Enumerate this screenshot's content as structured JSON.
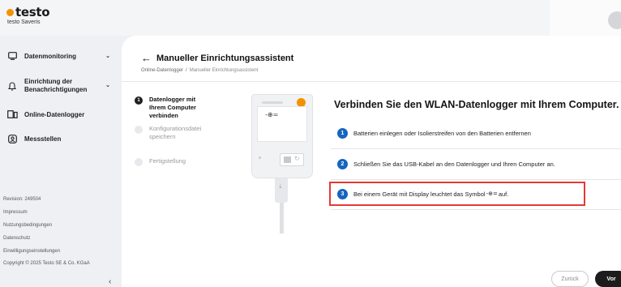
{
  "brand": {
    "name": "testo",
    "subtitle": "testo Saveris",
    "accent": "#f39200"
  },
  "sidebar": {
    "items": [
      {
        "label": "Datenmonitoring",
        "icon": "monitor-icon",
        "has_chevron": true
      },
      {
        "label": "Einrichtung der Benachrichtigungen",
        "icon": "bell-icon",
        "has_chevron": true
      },
      {
        "label": "Online-Datenlogger",
        "icon": "data-logger-icon",
        "has_chevron": false
      },
      {
        "label": "Messstellen",
        "icon": "measuring-point-icon",
        "has_chevron": false
      }
    ],
    "footer": {
      "revision": "Revision: 249504",
      "links": [
        "Impressum",
        "Nutzungsbedingungen",
        "Datenschutz",
        "Einwilligungseinstellungen"
      ],
      "copyright": "Copyright © 2025 Testo SE & Co. KGaA"
    }
  },
  "header": {
    "title": "Manueller Einrichtungsassistent",
    "breadcrumb": [
      "Online-Datenlogger",
      "Manueller Einrichtungsassistent"
    ]
  },
  "stepper": {
    "steps": [
      {
        "number": "1",
        "label": "Datenlogger mit Ihrem Computer verbinden",
        "state": "active"
      },
      {
        "number": "2",
        "label": "Konfigurationsdatei speichern",
        "state": "inactive"
      },
      {
        "number": "3",
        "label": "Fertigstellung",
        "state": "inactive"
      }
    ]
  },
  "instructions": {
    "title": "Verbinden Sie den WLAN-Datenlogger mit Ihrem Computer.",
    "steps": [
      {
        "number": "1",
        "text": "Batterien einlegen oder Isolierstreifen von den Batterien entfernen"
      },
      {
        "number": "2",
        "text": "Schließen Sie das USB-Kabel an den Datenlogger und Ihren Computer an."
      },
      {
        "number": "3",
        "text_before": "Bei einem Gerät mit Display leuchtet das Symbol",
        "symbol": "-⊕=",
        "text_after": "auf.",
        "highlighted": true
      }
    ]
  },
  "buttons": {
    "back": "Zurück",
    "next": "Vor"
  },
  "colors": {
    "badge": "#1565c0",
    "highlight": "#e53935",
    "primary_button": "#1c1c1c"
  }
}
